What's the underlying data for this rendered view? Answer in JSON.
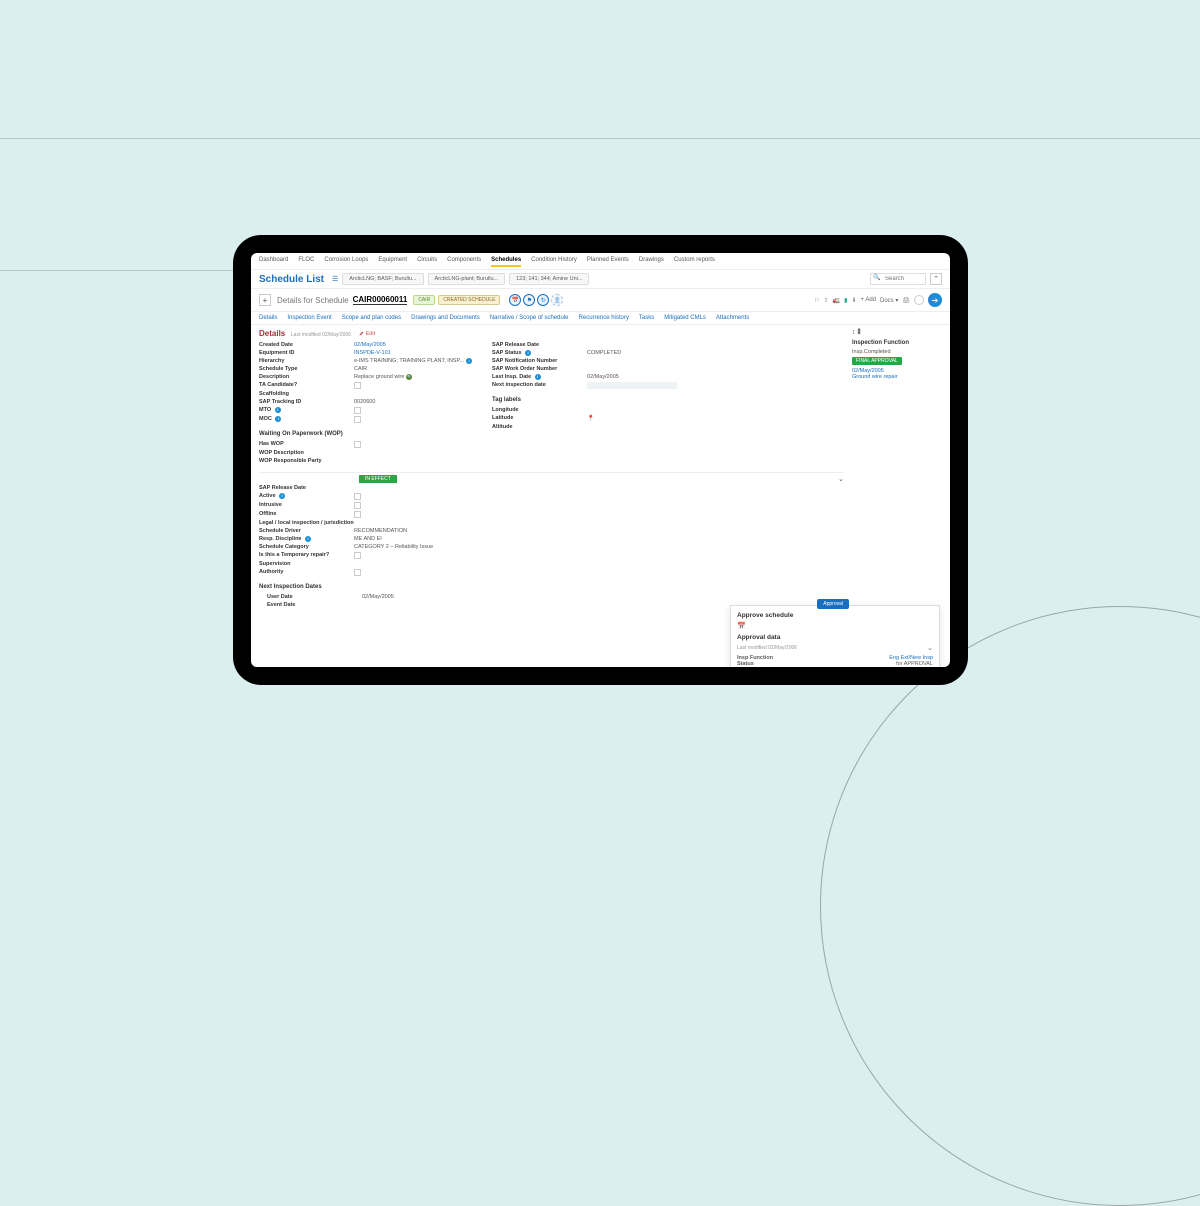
{
  "topnav": {
    "items": [
      "Dashboard",
      "FLOC",
      "Corrosion Loops",
      "Equipment",
      "Circuits",
      "Components",
      "Schedules",
      "Condition History",
      "Planned Events",
      "Drawings",
      "Custom reports"
    ],
    "active": "Schedules"
  },
  "subbar": {
    "title": "Schedule List",
    "crumbs": [
      "ArcticLNG; BASF; Burullu...",
      "ArcticLNG-plant; Burullu...",
      "123; 141; 344; Amine Uni..."
    ],
    "search_placeholder": "Search"
  },
  "detail_header": {
    "prefix": "Details for Schedule",
    "id": "CAIR00060011",
    "badge1": "CAIR",
    "badge2": "CREATED SCHEDULE",
    "actions": {
      "add": "Add",
      "docs": "Docs"
    }
  },
  "subtabs": [
    "Details",
    "Inspection Event",
    "Scope and plan codes",
    "Drawings and Documents",
    "Narrative / Scope of schedule",
    "Recurrence history",
    "Tasks",
    "Mitigated CMLs",
    "Attachments"
  ],
  "details": {
    "heading": "Details",
    "last_modified": "Last modified 02/May/2006",
    "edit": "Edit",
    "left": {
      "created_date": "02/May/2005",
      "equipment_id": "INSPDE-V-101",
      "hierarchy": "e-IMS TRAINING; TRAINING PLANT; INSP...",
      "schedule_type": "CAIR",
      "description": "Replace ground wire",
      "ta_candidate": "TA Candidate?",
      "scaffolding": "Scaffolding",
      "sap_tracking_id": "0020600",
      "mto": "MTO",
      "moc": "MOC"
    },
    "right": {
      "sap_release_date": "SAP Release Date",
      "sap_status": "SAP Status",
      "sap_notification": "SAP Notification Number",
      "sap_work_order": "SAP Work Order Number",
      "last_insp_date": "Last Insp. Date",
      "last_insp_value": "02/May/2005",
      "next_inspection": "Next inspection date",
      "completed": "COMPLETED",
      "tag_labels": "Tag labels",
      "longitude": "Longitude",
      "latitude": "Latitude",
      "altitude": "Altitude"
    },
    "wop": {
      "heading": "Waiting On Paperwork (WOP)",
      "has_wop": "Has WOP",
      "wop_desc": "WOP Description",
      "wop_resp": "WOP Responsible Party"
    }
  },
  "side": {
    "heading": "Inspection Function",
    "status": "Insp.Completed",
    "approval": "FINAL APPROVAL",
    "date": "02/May/2005",
    "note": "Ground wire repair"
  },
  "section2": {
    "in_effect": "IN EFFECT",
    "rows": {
      "sap_release_date": "SAP Release Date",
      "active": "Active",
      "intrusive": "Intrusive",
      "offline": "Offline",
      "legal": "Legal / local inspection / jurisdiction",
      "schedule_driver_label": "Schedule Driver",
      "schedule_driver": "RECOMMENDATION",
      "resp_discipline_label": "Resp. Discipline",
      "resp_discipline": "ME AND EI",
      "schedule_category_label": "Schedule Category",
      "schedule_category": "CATEGORY 2 – Reliability Issue",
      "temp_repair": "Is this a Temporary repair?",
      "supervision": "Supervision",
      "authority": "Authority"
    },
    "next_dates": {
      "heading": "Next Inspection Dates",
      "user_date_label": "User Date",
      "user_date": "02/May/2005",
      "event_date": "Event Date"
    }
  },
  "approve_panel": {
    "pill": "Approval",
    "title": "Approve schedule",
    "approval_data": "Approval data",
    "meta": "Last modified 02/May/2006",
    "insp_function": "Insp Function",
    "insp_function_val": "Eng Ext/New Insp",
    "status_label": "Status",
    "status_val": "for APPROVAL"
  }
}
